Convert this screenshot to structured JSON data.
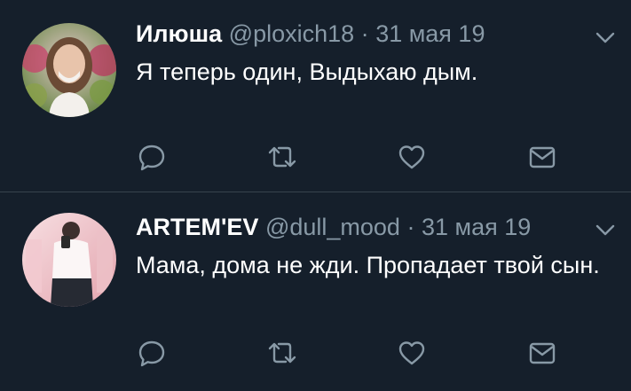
{
  "colors": {
    "background": "#151f2b",
    "divider": "#38444d",
    "text": "#ffffff",
    "secondary_text": "#8899a6",
    "icon": "#8899a6"
  },
  "tweets": [
    {
      "display_name": "Илюша",
      "handle": "@ploxich18",
      "separator": "·",
      "date": "31 мая 19",
      "text": "Я теперь один, Выдыхаю дым.",
      "actions": [
        "reply-icon",
        "retweet-icon",
        "like-icon",
        "direct-message-icon"
      ]
    },
    {
      "display_name": "ARTEM'EV",
      "handle": "@dull_mood",
      "separator": "·",
      "date": "31 мая 19",
      "text": "Мама, дома не жди. Пропадает твой сын.",
      "actions": [
        "reply-icon",
        "retweet-icon",
        "like-icon",
        "direct-message-icon"
      ]
    }
  ]
}
